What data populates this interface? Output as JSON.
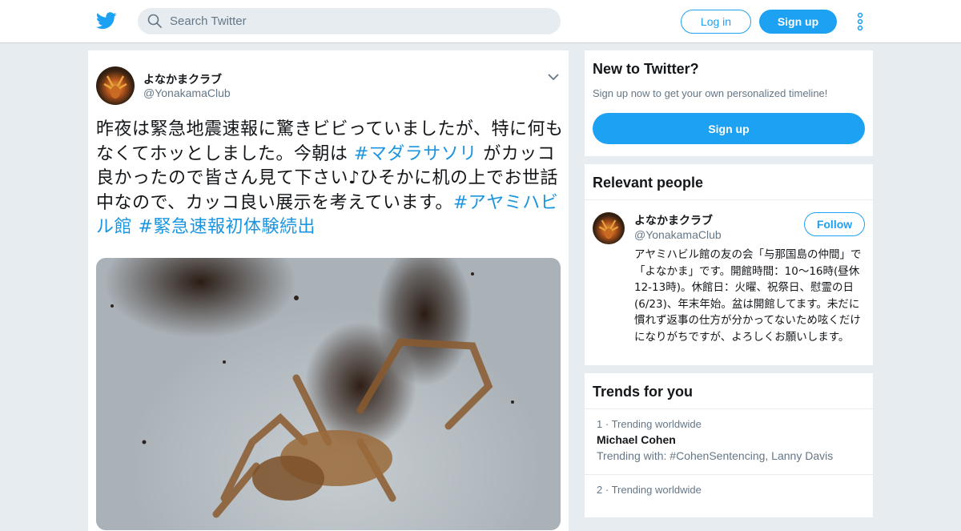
{
  "topbar": {
    "search_placeholder": "Search Twitter",
    "login_label": "Log in",
    "signup_label": "Sign up",
    "brand_color": "#1da1f2"
  },
  "tweet": {
    "author_name": "よなかまクラブ",
    "author_handle": "@YonakamaClub",
    "text_parts": [
      {
        "text": "昨夜は緊急地震速報に驚きビビっていましたが、特に何もなくてホッとしました。今朝は ",
        "tag": false
      },
      {
        "text": "#マダラサソリ",
        "tag": true
      },
      {
        "text": " がカッコ良かったので皆さん見て下さい♪ひそかに机の上でお世話中なので、カッコ良い展示を考えています。",
        "tag": false
      },
      {
        "text": "#アヤミハビル館",
        "tag": true
      },
      {
        "text": " ",
        "tag": false
      },
      {
        "text": "#緊急速報初体験続出",
        "tag": true
      }
    ],
    "photo_icon": "scorpion-photo"
  },
  "new_to_twitter": {
    "title": "New to Twitter?",
    "subtitle": "Sign up now to get your own personalized timeline!",
    "signup_label": "Sign up"
  },
  "relevant_people": {
    "title": "Relevant people",
    "person": {
      "name": "よなかまクラブ",
      "handle": "@YonakamaClub",
      "follow_label": "Follow",
      "bio": "アヤミハビル館の友の会「与那国島の仲間」で「よなかま」です。開館時間：10～16時(昼休12-13時)。休館日：火曜、祝祭日、慰霊の日(6/23)、年末年始。盆は開館してます。未だに慣れず返事の仕方が分かってないため呟くだけになりがちですが、よろしくお願いします。"
    }
  },
  "trends": {
    "title": "Trends for you",
    "items": [
      {
        "rank": "1",
        "meta": "Trending worldwide",
        "name": "Michael Cohen",
        "with": "Trending with: #CohenSentencing, Lanny Davis"
      },
      {
        "rank": "2",
        "meta": "Trending worldwide",
        "name": "",
        "with": ""
      }
    ]
  }
}
